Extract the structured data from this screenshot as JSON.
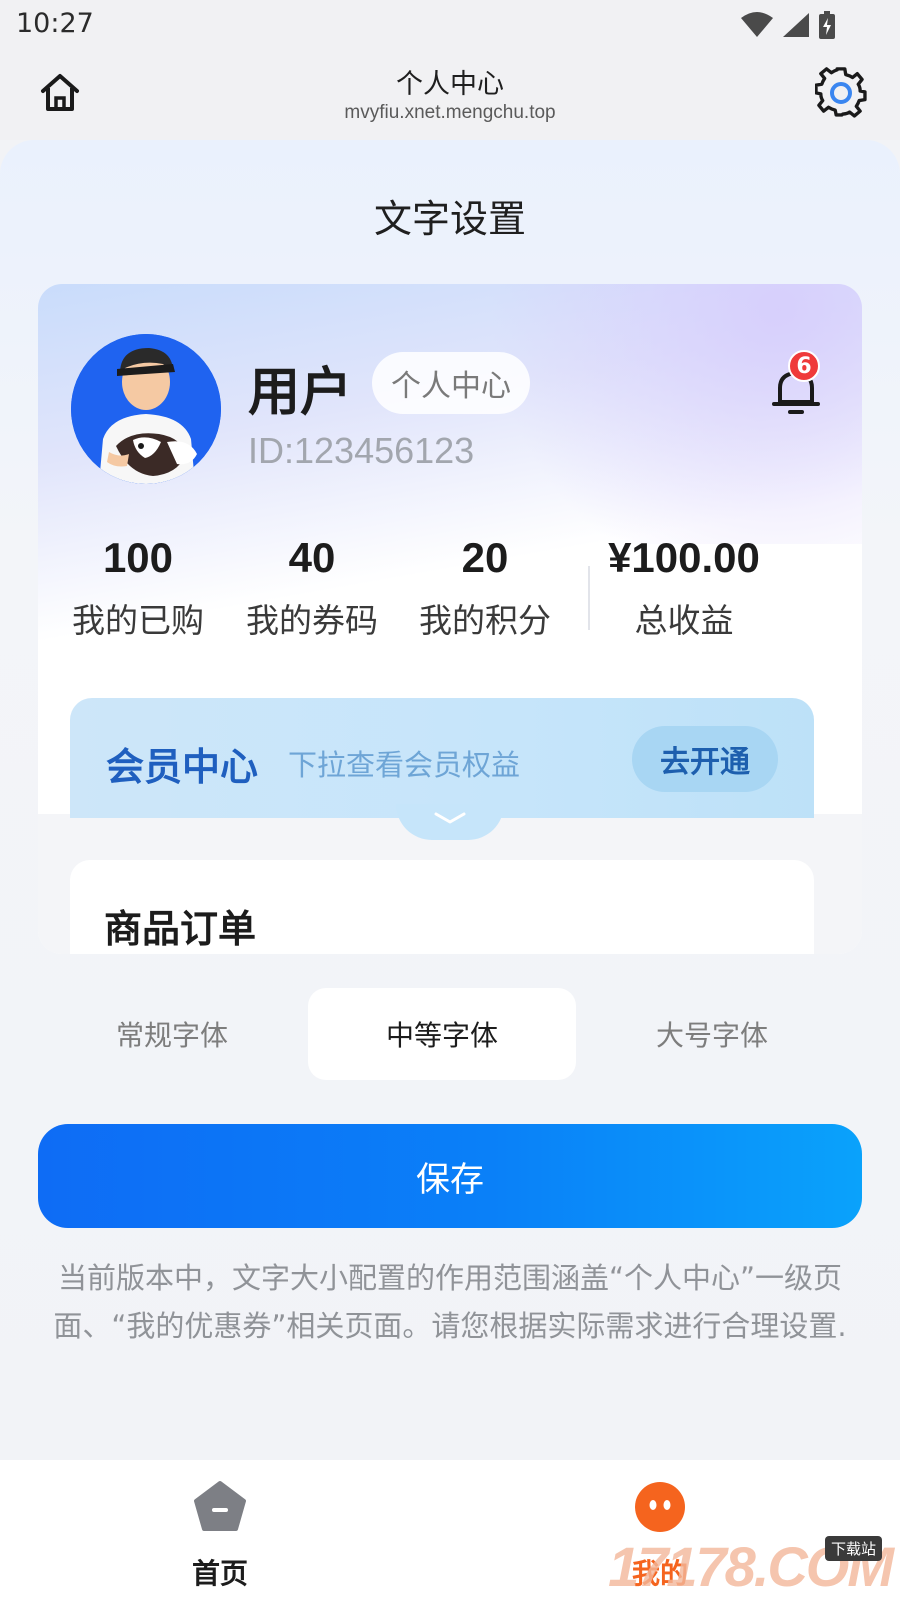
{
  "status_bar": {
    "time": "10:27",
    "icons": [
      "wifi-icon",
      "signal-icon",
      "battery-icon"
    ]
  },
  "header": {
    "title": "个人中心",
    "url": "mvyfiu.xnet.mengchu.top",
    "left_icon": "home-icon",
    "right_icon": "gear-icon"
  },
  "page": {
    "title": "文字设置"
  },
  "preview": {
    "username": "用户",
    "tag": "个人中心",
    "user_id": "ID:123456123",
    "notification_count": "6",
    "stats": [
      {
        "value": "100",
        "label": "我的已购"
      },
      {
        "value": "40",
        "label": "我的券码"
      },
      {
        "value": "20",
        "label": "我的积分"
      },
      {
        "value": "¥100.00",
        "label": "总收益"
      }
    ],
    "member": {
      "title": "会员中心",
      "subtitle": "下拉查看会员权益",
      "button": "去开通"
    },
    "orders_title": "商品订单"
  },
  "font_options": {
    "options": [
      "常规字体",
      "中等字体",
      "大号字体"
    ],
    "selected": "中等字体"
  },
  "save_label": "保存",
  "notice": "当前版本中，文字大小配置的作用范围涵盖“个人中心”一级页面、“我的优惠券”相关页面。请您根据实际需求进行合理设置.",
  "bottom_nav": {
    "items": [
      {
        "label": "首页",
        "icon": "home-tab-icon",
        "active": false
      },
      {
        "label": "我的",
        "icon": "profile-tab-icon",
        "active": true
      }
    ]
  },
  "watermark": {
    "text": "17178.COM",
    "sub": "下载站"
  },
  "colors": {
    "accent": "#0e6cf5",
    "active_tab": "#f5641e",
    "member_title": "#1f5fbf",
    "badge": "#ef3a3a"
  }
}
